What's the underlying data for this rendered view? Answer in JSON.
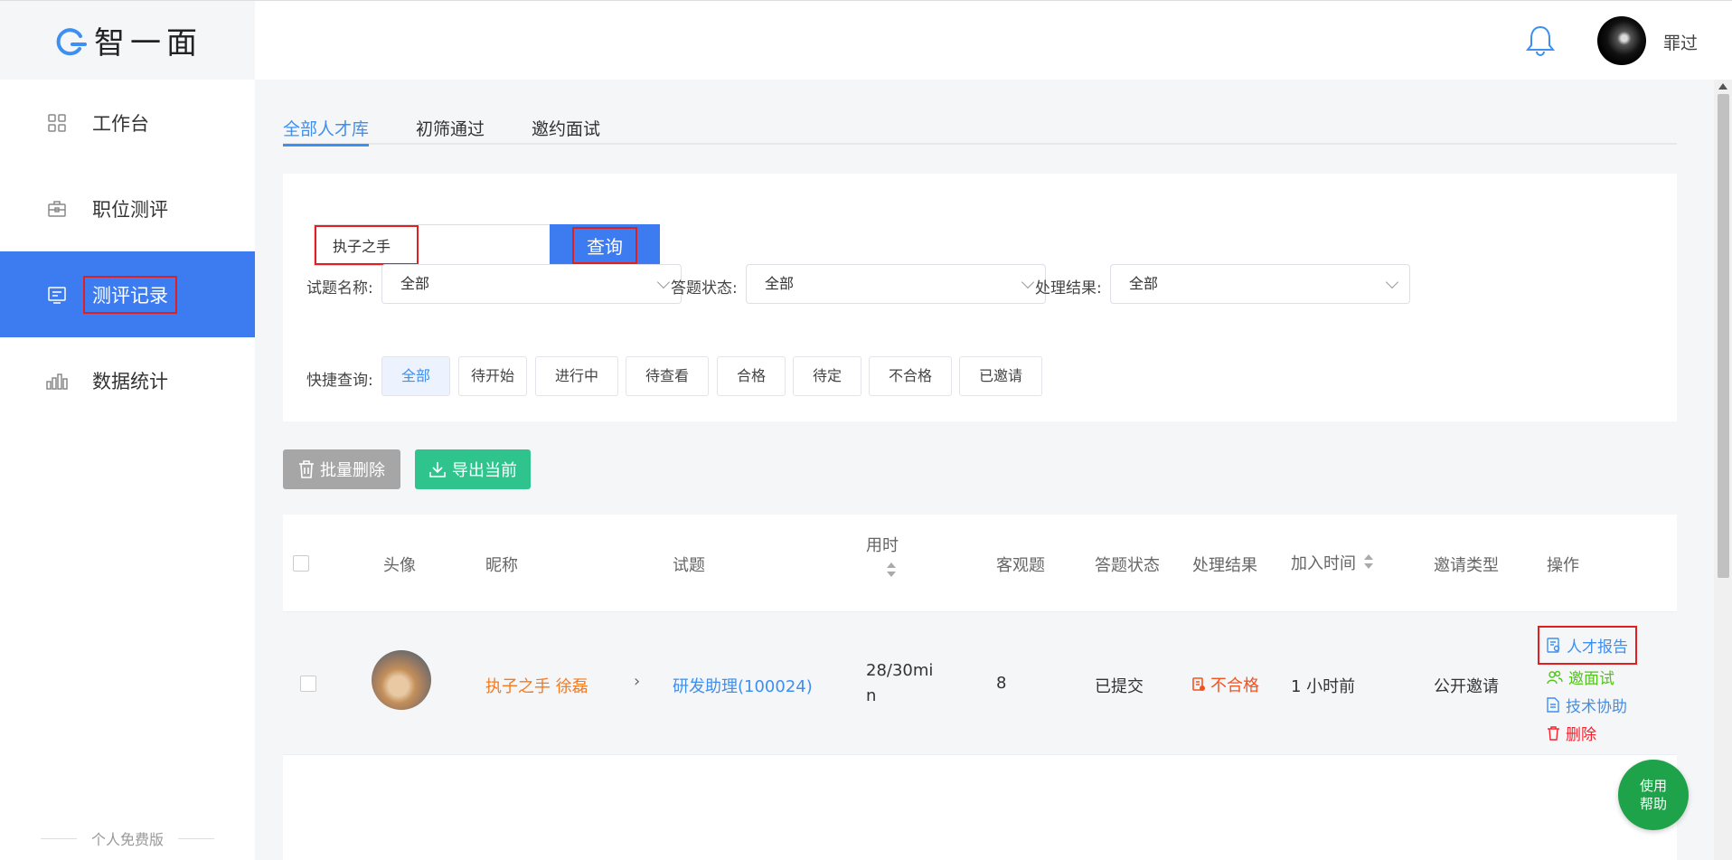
{
  "brand": {
    "name": "智一面"
  },
  "sidebar": {
    "items": [
      {
        "label": "工作台",
        "icon": "grid-icon"
      },
      {
        "label": "职位测评",
        "icon": "briefcase-icon"
      },
      {
        "label": "测评记录",
        "icon": "record-icon"
      },
      {
        "label": "数据统计",
        "icon": "bar-chart-icon"
      }
    ],
    "footer": "个人免费版"
  },
  "header": {
    "username": "罪过"
  },
  "tabs": [
    "全部人才库",
    "初筛通过",
    "邀约面试"
  ],
  "search": {
    "value": "执子之手",
    "button": "查询"
  },
  "filters": {
    "exam_label": "试题名称:",
    "exam_value": "全部",
    "status_label": "答题状态:",
    "status_value": "全部",
    "result_label": "处理结果:",
    "result_value": "全部",
    "quick_label": "快捷查询:",
    "quick": [
      "全部",
      "待开始",
      "进行中",
      "待查看",
      "合格",
      "待定",
      "不合格",
      "已邀请"
    ]
  },
  "actions": {
    "batch_delete": "批量删除",
    "export": "导出当前"
  },
  "table": {
    "headers": {
      "avatar": "头像",
      "nickname": "昵称",
      "exam": "试题",
      "duration": "用时",
      "objective": "客观题",
      "status": "答题状态",
      "result": "处理结果",
      "joined": "加入时间",
      "invite_type": "邀请类型",
      "ops": "操作"
    },
    "rows": [
      {
        "nickname": "执子之手 徐磊",
        "exam": "研发助理(100024)",
        "duration_line1": "28/30mi",
        "duration_line2": "n",
        "objective": "8",
        "status": "已提交",
        "result": "不合格",
        "joined": "1 小时前",
        "invite_type": "公开邀请",
        "ops": {
          "report": "人才报告",
          "invite": "邀面试",
          "tech": "技术协助",
          "delete": "删除"
        }
      }
    ]
  },
  "help": {
    "line1": "使用",
    "line2": "帮助"
  },
  "colors": {
    "primary": "#3d7cf0",
    "link": "#3d8ff2",
    "orange": "#f57a1f",
    "green": "#2fc48d",
    "danger": "#f5222d"
  }
}
